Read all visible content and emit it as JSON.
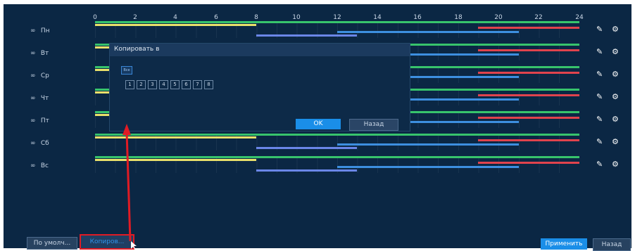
{
  "hours": [
    "0",
    "2",
    "4",
    "6",
    "8",
    "10",
    "12",
    "14",
    "16",
    "18",
    "20",
    "22",
    "24"
  ],
  "days": [
    {
      "label": "Пн"
    },
    {
      "label": "Вт"
    },
    {
      "label": "Ср"
    },
    {
      "label": "Чт"
    },
    {
      "label": "Пт"
    },
    {
      "label": "Сб"
    },
    {
      "label": "Вс"
    }
  ],
  "colors": {
    "green": "#37c46c",
    "yellow": "#e9e06a",
    "red": "#e0434d",
    "blue": "#3d8fe0",
    "violet": "#6a86e8",
    "accent": "#1a8ee8",
    "highlight": "#e01b24"
  },
  "icons": {
    "chain": "link-icon",
    "pencil": "pencil-icon",
    "gear": "gear-icon"
  },
  "dialog": {
    "title": "Копировать в",
    "all_label": "Все",
    "day_numbers": [
      "1",
      "2",
      "3",
      "4",
      "5",
      "6",
      "7",
      "8"
    ],
    "ok_label": "OK",
    "back_label": "Назад"
  },
  "buttons": {
    "default_label": "По умолч...",
    "copy_label": "Копиров...",
    "apply_label": "Применить",
    "back_label": "Назад"
  }
}
